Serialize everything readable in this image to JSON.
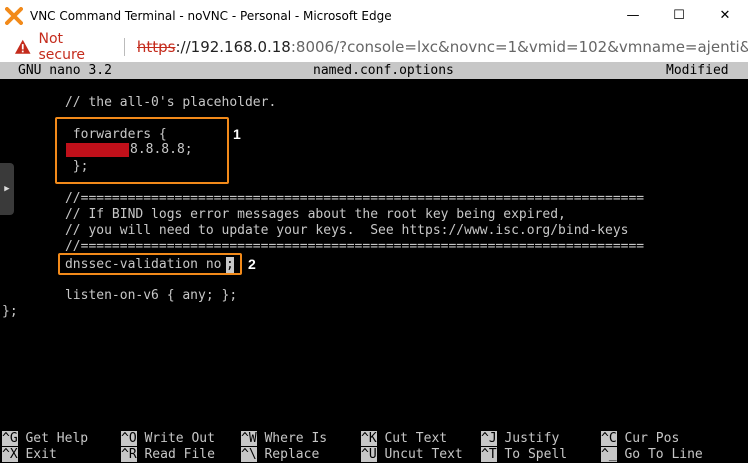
{
  "window": {
    "title": "VNC Command Terminal - noVNC - Personal - Microsoft Edge",
    "minimize": "—",
    "maximize": "☐",
    "close": "✕"
  },
  "address": {
    "security_label": "Not secure",
    "url_protocol": "https",
    "url_host": "://192.168.0.18",
    "url_rest": ":8006/?console=lxc&novnc=1&vmid=102&vmname=ajenti&..."
  },
  "nano": {
    "version": "GNU nano 3.2",
    "filename": "named.conf.options",
    "status": "Modified"
  },
  "file_lines": {
    "l1": "      // the all-0's placeholder.",
    "l2": "       forwarders {",
    "l3": "8.8.8.8;",
    "l4": "       };",
    "l5": "      //========================================================================",
    "l6": "      // If BIND logs error messages about the root key being expired,",
    "l7": "      // you will need to update your keys.  See https://www.isc.org/bind-keys",
    "l8": "      //========================================================================",
    "l9": "      dnssec-validation no",
    "l9_cursor": ";",
    "l10": "      listen-on-v6 { any; };",
    "l11": "};"
  },
  "callouts": {
    "one": "1",
    "two": "2"
  },
  "shortcuts": [
    {
      "key": "^G",
      "label": "Get Help"
    },
    {
      "key": "^O",
      "label": "Write Out"
    },
    {
      "key": "^W",
      "label": "Where Is"
    },
    {
      "key": "^K",
      "label": "Cut Text"
    },
    {
      "key": "^J",
      "label": "Justify"
    },
    {
      "key": "^C",
      "label": "Cur Pos"
    },
    {
      "key": "^X",
      "label": "Exit"
    },
    {
      "key": "^R",
      "label": "Read File"
    },
    {
      "key": "^\\",
      "label": "Replace"
    },
    {
      "key": "^U",
      "label": "Uncut Text"
    },
    {
      "key": "^T",
      "label": "To Spell"
    },
    {
      "key": "^_",
      "label": "Go To Line"
    }
  ],
  "colors": {
    "accent_callout": "#f28a1a",
    "redaction": "#c0101a",
    "insecure": "#c42b1c"
  }
}
